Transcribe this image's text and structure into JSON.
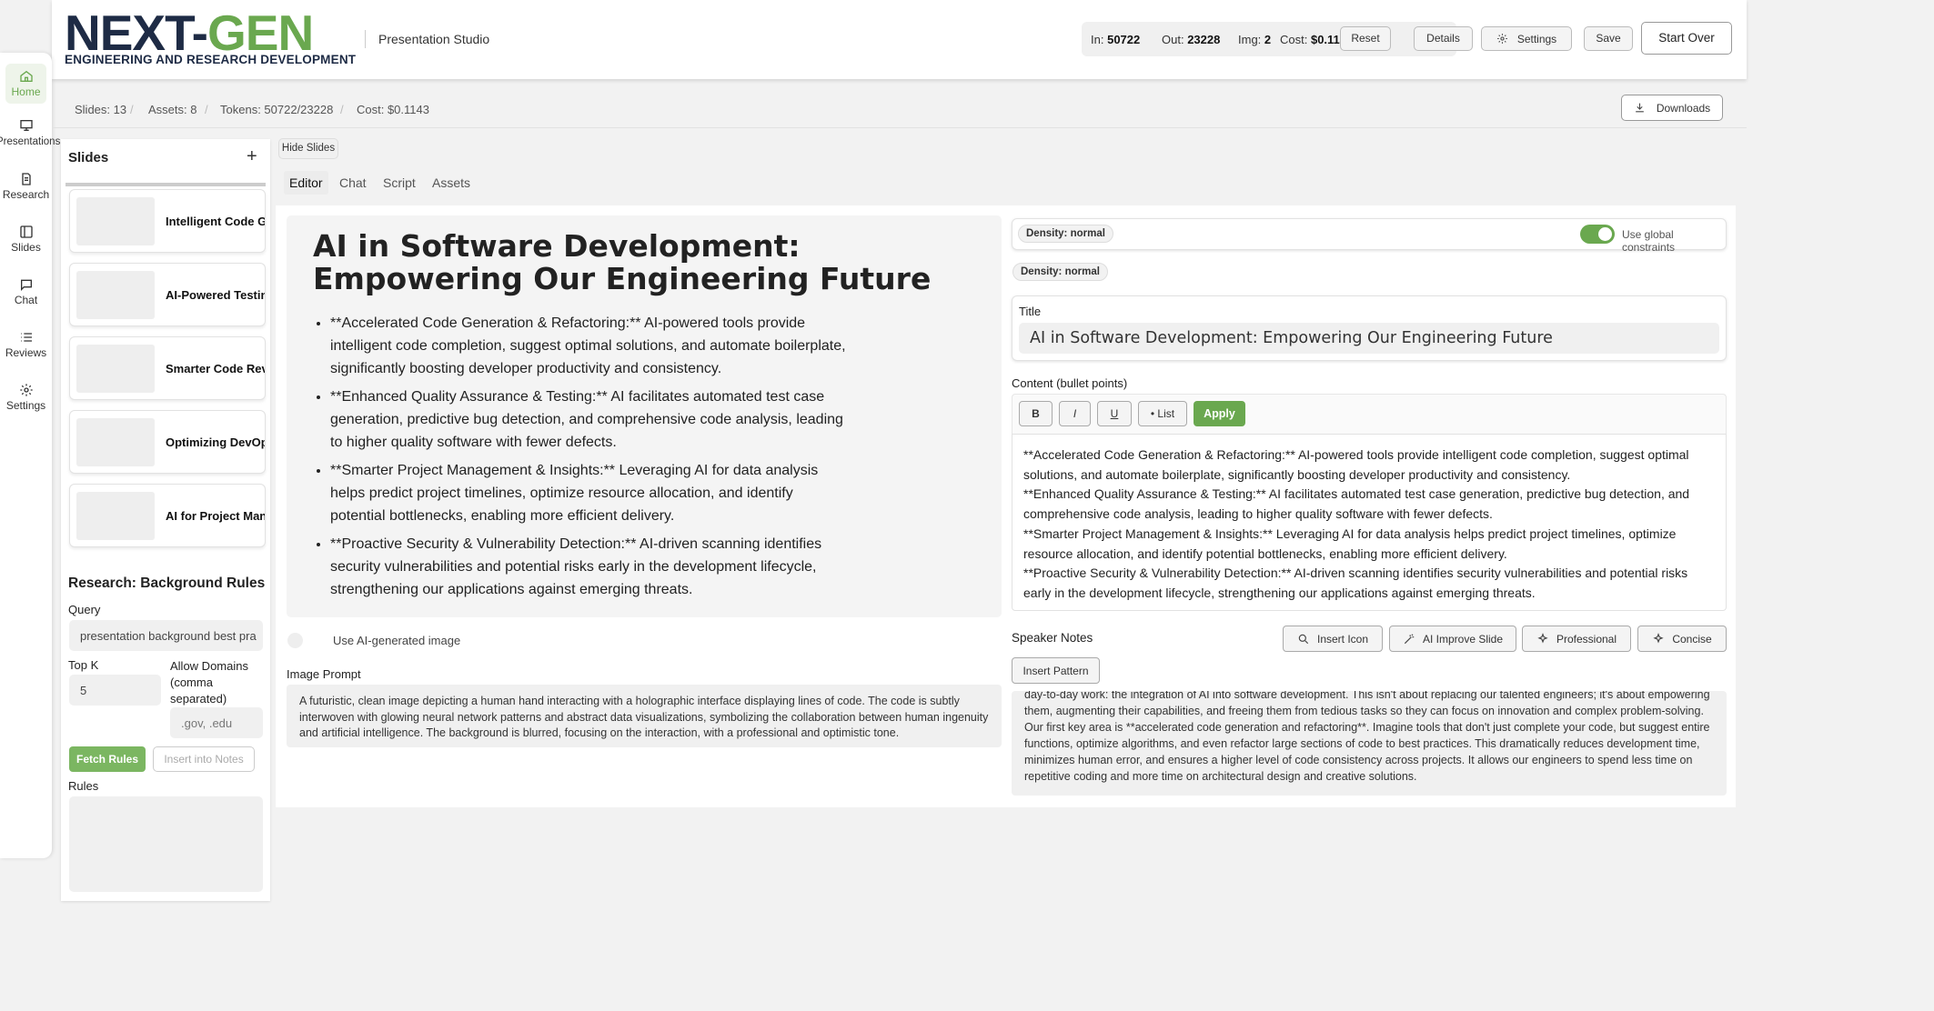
{
  "header": {
    "logo_main_a": "NE",
    "logo_main_x": "X",
    "logo_main_b": "T-",
    "logo_main_gen": "GEN",
    "logo_sub": "ENGINEERING AND RESEARCH DEVELOPMENT",
    "studio_label": "Presentation Studio",
    "stats": {
      "in_label": "In:",
      "in_value": "50722",
      "out_label": "Out:",
      "out_value": "23228",
      "img_label": "Img:",
      "img_value": "2",
      "cost_label": "Cost:",
      "cost_value": "$0.1143"
    },
    "reset_label": "Reset",
    "details_label": "Details",
    "settings_label": "Settings",
    "save_label": "Save",
    "start_over_label": "Start Over"
  },
  "subbar": {
    "slides": "Slides: 13",
    "assets": "Assets: 8",
    "tokens": "Tokens: 50722/23228",
    "cost": "Cost: $0.1143",
    "downloads_label": "Downloads"
  },
  "rail": [
    {
      "label": "Home",
      "icon": "home-icon"
    },
    {
      "label": "Presentations",
      "icon": "presentation-icon"
    },
    {
      "label": "Research",
      "icon": "document-icon"
    },
    {
      "label": "Slides",
      "icon": "slides-icon"
    },
    {
      "label": "Chat",
      "icon": "chat-icon"
    },
    {
      "label": "Reviews",
      "icon": "list-icon"
    },
    {
      "label": "Settings",
      "icon": "gear-icon"
    }
  ],
  "slides_panel": {
    "title": "Slides",
    "add_symbol": "+",
    "hide_label": "Hide Slides",
    "items": [
      {
        "title": "Intelligent Code Gen"
      },
      {
        "title": "AI-Powered Testing"
      },
      {
        "title": "Smarter Code Revie"
      },
      {
        "title": "Optimizing DevOps"
      },
      {
        "title": "AI for Project Mana"
      }
    ]
  },
  "research": {
    "title": "Research: Background Rules",
    "query_label": "Query",
    "query_value": "presentation background best pra",
    "topk_label": "Top K",
    "topk_value": "5",
    "domains_label_1": "Allow Domains",
    "domains_label_2": "(comma",
    "domains_label_3": "separated)",
    "domains_placeholder": ".gov, .edu",
    "fetch_label": "Fetch Rules",
    "insert_label": "Insert into Notes",
    "rules_label": "Rules"
  },
  "tabs": [
    "Editor",
    "Chat",
    "Script",
    "Assets"
  ],
  "preview": {
    "title": "AI in Software Development: Empowering Our Engineering Future",
    "bullets": [
      "**Accelerated Code Generation & Refactoring:** AI-powered tools provide intelligent code completion, suggest optimal solutions, and automate boilerplate, significantly boosting developer productivity and consistency.",
      "**Enhanced Quality Assurance & Testing:** AI facilitates automated test case generation, predictive bug detection, and comprehensive code analysis, leading to higher quality software with fewer defects.",
      "**Smarter Project Management & Insights:** Leveraging AI for data analysis helps predict project timelines, optimize resource allocation, and identify potential bottlenecks, enabling more efficient delivery.",
      "**Proactive Security & Vulnerability Detection:** AI-driven scanning identifies security vulnerabilities and potential risks early in the development lifecycle, strengthening our applications against emerging threats."
    ],
    "ai_image_label": "Use AI-generated image",
    "image_prompt_label": "Image Prompt",
    "image_prompt": "A futuristic, clean image depicting a human hand interacting with a holographic interface displaying lines of code. The code is subtly interwoven with glowing neural network patterns and abstract data visualizations, symbolizing the collaboration between human ingenuity and artificial intelligence. The background is blurred, focusing on the interaction, with a professional and optimistic tone."
  },
  "editor": {
    "density_1": "Density: normal",
    "density_2": "Density: normal",
    "global_constraints_label": "Use global constraints",
    "global_constraints_on": true,
    "title_label": "Title",
    "title_value": "AI in Software Development: Empowering Our Engineering Future",
    "content_label": "Content (bullet points)",
    "fmt_bold": "B",
    "fmt_italic": "I",
    "fmt_underline": "U",
    "fmt_list": "• List",
    "apply_label": "Apply",
    "content_lines": [
      "**Accelerated Code Generation & Refactoring:** AI-powered tools provide intelligent code completion, suggest optimal solutions, and automate boilerplate, significantly boosting developer productivity and consistency.",
      "**Enhanced Quality Assurance & Testing:** AI facilitates automated test case generation, predictive bug detection, and comprehensive code analysis, leading to higher quality software with fewer defects.",
      "**Smarter Project Management & Insights:** Leveraging AI for data analysis helps predict project timelines, optimize resource allocation, and identify potential bottlenecks, enabling more efficient delivery.",
      "**Proactive Security & Vulnerability Detection:** AI-driven scanning identifies security vulnerabilities and potential risks early in the development lifecycle, strengthening our applications against emerging threats."
    ],
    "speaker_notes_label": "Speaker Notes",
    "insert_icon_label": "Insert Icon",
    "ai_improve_label": "AI Improve Slide",
    "professional_label": "Professional",
    "concise_label": "Concise",
    "insert_pattern_label": "Insert Pattern",
    "speaker_notes": "day-to-day work: the integration of AI into software development. This isn't about replacing our talented engineers; it's about empowering them, augmenting their capabilities, and freeing them from tedious tasks so they can focus on innovation and complex problem-solving. Our first key area is **accelerated code generation and refactoring**. Imagine tools that don't just complete your code, but suggest entire functions, optimize algorithms, and even refactor large sections of code to best practices. This dramatically reduces development time, minimizes human error, and ensures a higher level of code consistency across projects. It allows our engineers to spend less time on repetitive coding and more time on architectural design and creative solutions."
  },
  "colors": {
    "accent": "#6aa84f",
    "brand_navy": "#1e2b45"
  }
}
